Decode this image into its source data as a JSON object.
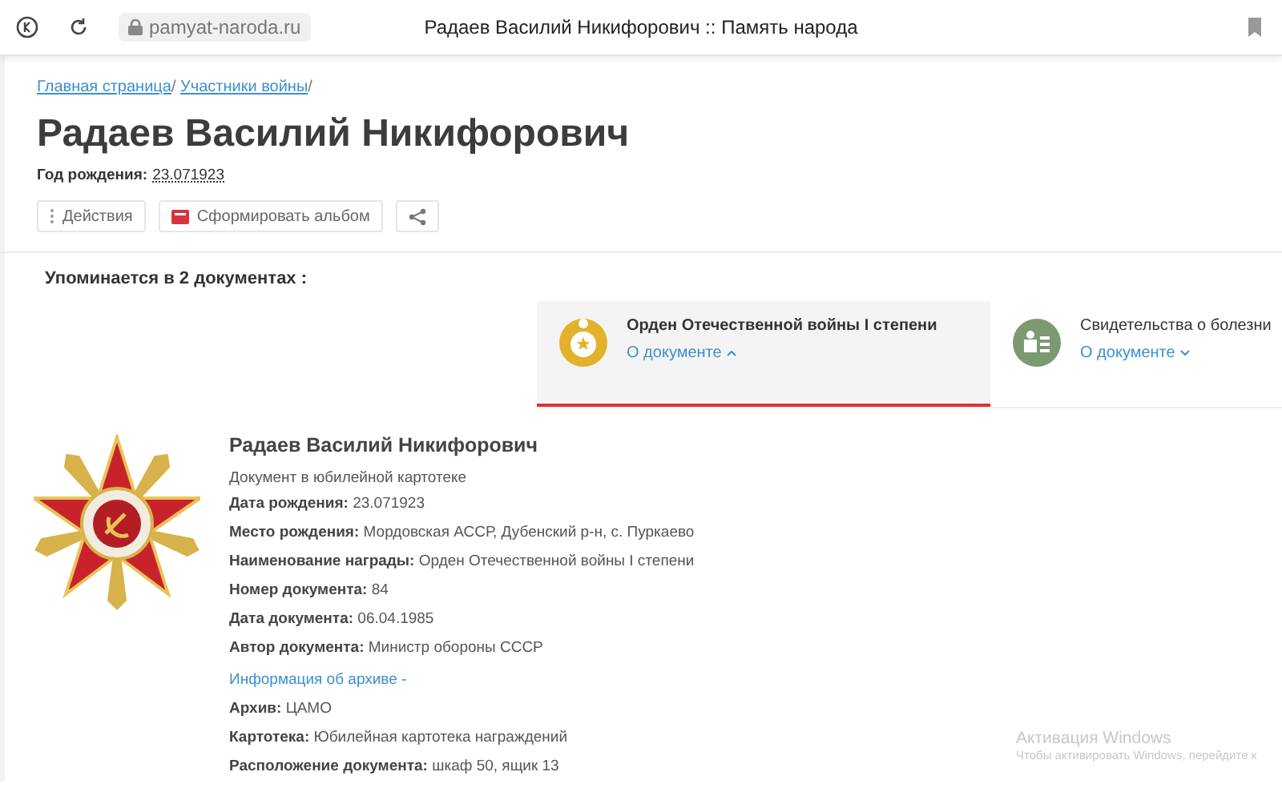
{
  "browser": {
    "url": "pamyat-naroda.ru",
    "title": "Радаев Василий Никифорович :: Память народа"
  },
  "breadcrumbs": [
    {
      "label": "Главная страница",
      "separator": "/"
    },
    {
      "label": "Участники войны",
      "separator": "/"
    }
  ],
  "person": {
    "name": "Радаев Василий Никифорович",
    "birth_label": "Год рождения:",
    "birth_value": "23.071923"
  },
  "actions": [
    {
      "kind": "menu",
      "label": "Действия"
    },
    {
      "kind": "album",
      "label": "Сформировать альбом"
    },
    {
      "kind": "share"
    }
  ],
  "mentions": "Упоминается в 2 документах :",
  "documents": [
    {
      "kind": "award",
      "title": "Орден Отечественной войны I степени",
      "link": "О документе",
      "selected": true,
      "expanded": true,
      "color": "#e4b12c"
    },
    {
      "kind": "medical",
      "title": "Свидетельства о болезни",
      "link": "О документе",
      "selected": false,
      "expanded": false,
      "color": "#7b9a72"
    }
  ],
  "detail": {
    "name": "Радаев Василий Никифорович",
    "subtitle": "Документ в юбилейной картотеке",
    "fields": [
      {
        "kind": "field",
        "label": "Дата рождения:",
        "value": "23.071923"
      },
      {
        "kind": "field",
        "label": "Место рождения:",
        "value": "Мордовская АССР, Дубенский р-н, с. Пуркаево"
      },
      {
        "kind": "field",
        "label": "Наименование награды:",
        "value": "Орден Отечественной войны I степени"
      },
      {
        "kind": "field",
        "label": "Номер документа:",
        "value": "84"
      },
      {
        "kind": "field",
        "label": "Дата документа:",
        "value": "06.04.1985"
      },
      {
        "kind": "field",
        "label": "Автор документа:",
        "value": "Министр обороны СССР"
      },
      {
        "kind": "link",
        "label": "Информация об архиве -"
      },
      {
        "kind": "field",
        "label": "Архив:",
        "value": "ЦАМО"
      },
      {
        "kind": "field",
        "label": "Картотека:",
        "value": "Юбилейная картотека награждений"
      },
      {
        "kind": "field",
        "label": "Расположение документа:",
        "value": "шкаф 50, ящик 13"
      }
    ]
  },
  "os_notice": {
    "title": "Активация Windows",
    "text": "Чтобы активировать Windows, перейдите к"
  }
}
